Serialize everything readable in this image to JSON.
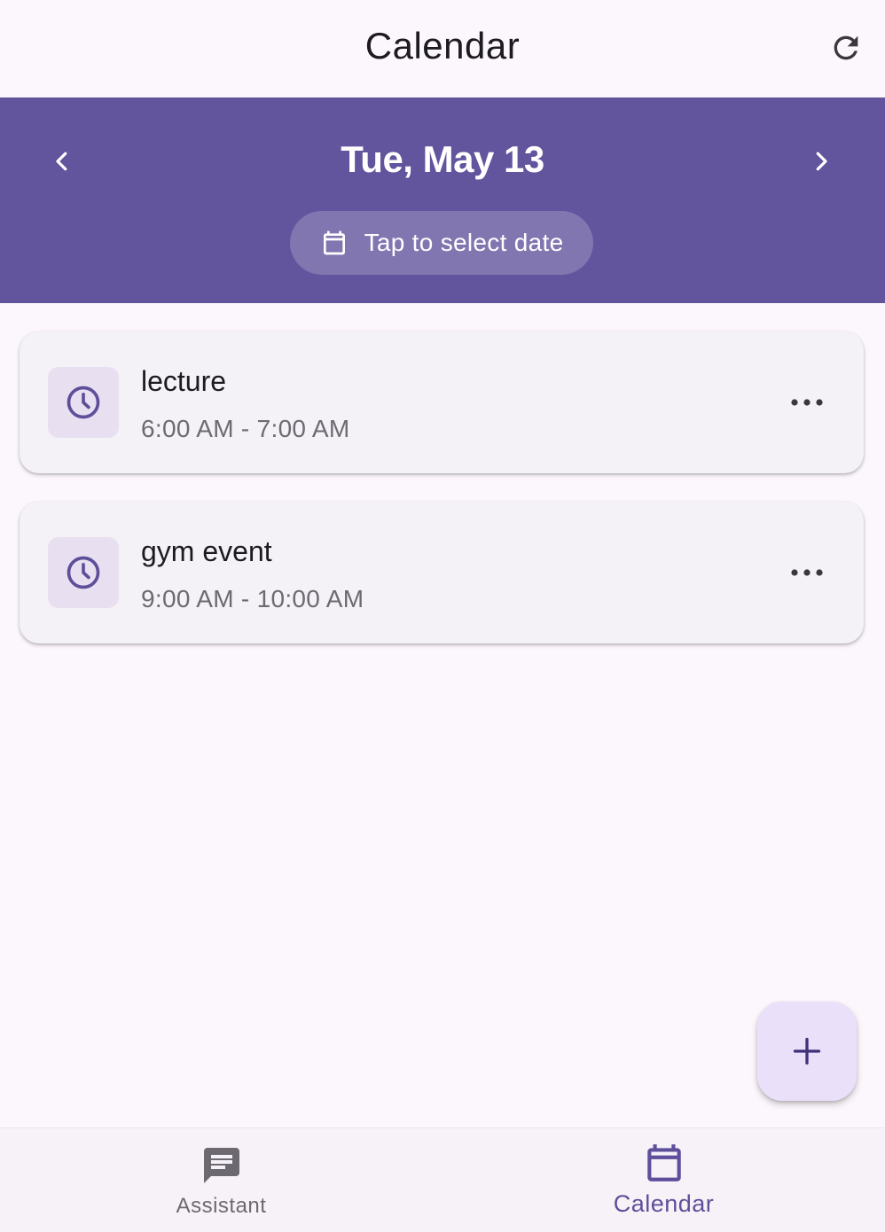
{
  "appbar": {
    "title": "Calendar",
    "refresh_icon": "refresh-icon"
  },
  "date_header": {
    "date_label": "Tue, May 13",
    "select_date_label": "Tap to select date",
    "prev_icon": "chevron-left-icon",
    "next_icon": "chevron-right-icon"
  },
  "events": [
    {
      "title": "lecture",
      "time": "6:00 AM - 7:00 AM",
      "icon": "clock-icon"
    },
    {
      "title": "gym event",
      "time": "9:00 AM - 10:00 AM",
      "icon": "clock-icon"
    }
  ],
  "fab": {
    "icon": "plus-icon"
  },
  "bottom_nav": {
    "items": [
      {
        "label": "Assistant",
        "icon": "chat-icon",
        "selected": false
      },
      {
        "label": "Calendar",
        "icon": "calendar-icon",
        "selected": true
      }
    ]
  },
  "colors": {
    "primary": "#62549d",
    "background": "#fcf7fc",
    "card": "#f4f1f7",
    "fab": "#eae0fa",
    "selected_nav": "#5e4f9a"
  }
}
